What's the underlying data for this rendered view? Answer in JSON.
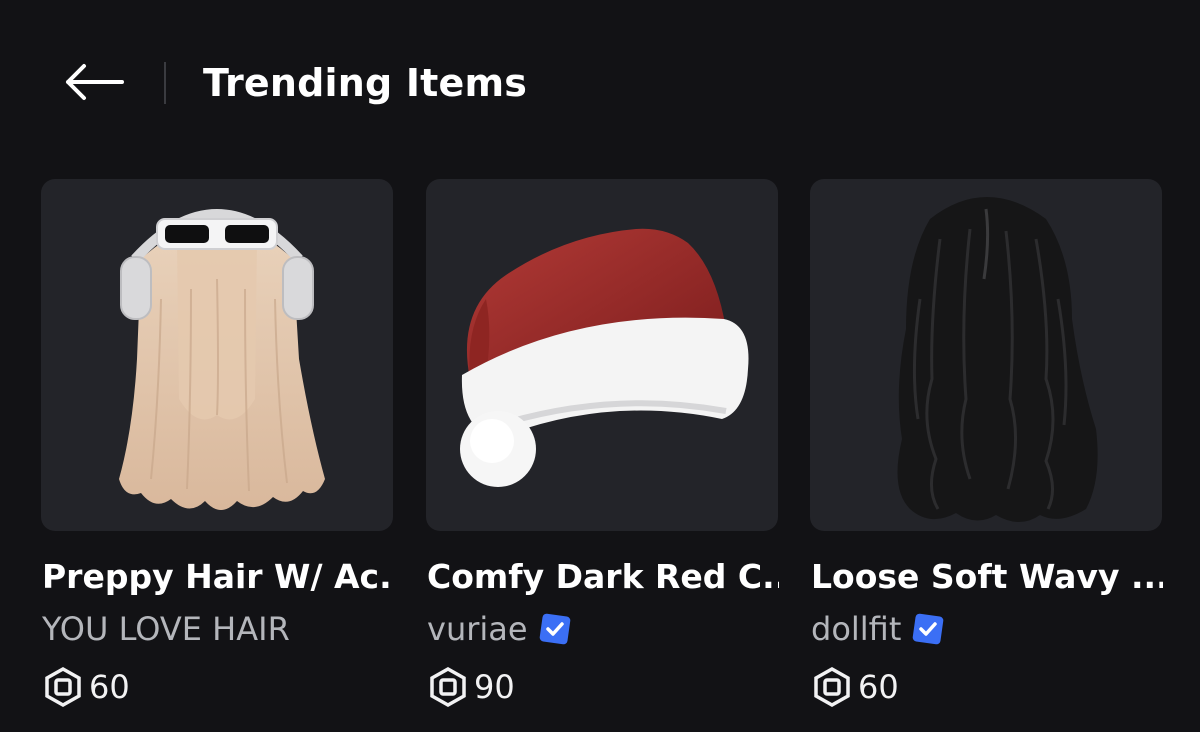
{
  "header": {
    "back_icon": "arrow-left-icon",
    "title": "Trending Items"
  },
  "items": [
    {
      "name": "Preppy Hair W/ Ac...",
      "creator": "YOU LOVE HAIR",
      "verified": false,
      "price": "60",
      "thumbnail_icon": "blonde-hair-with-headphones-sunglasses"
    },
    {
      "name": "Comfy Dark Red C...",
      "creator": "vuriae",
      "verified": true,
      "price": "90",
      "thumbnail_icon": "santa-hat"
    },
    {
      "name": "Loose Soft Wavy ...",
      "creator": "dollfit",
      "verified": true,
      "price": "60",
      "thumbnail_icon": "black-wavy-hair"
    }
  ],
  "colors": {
    "background": "#121215",
    "card_bg": "#232429",
    "verified_blue": "#3b6ff5",
    "secondary_text": "#b4b6bb"
  }
}
